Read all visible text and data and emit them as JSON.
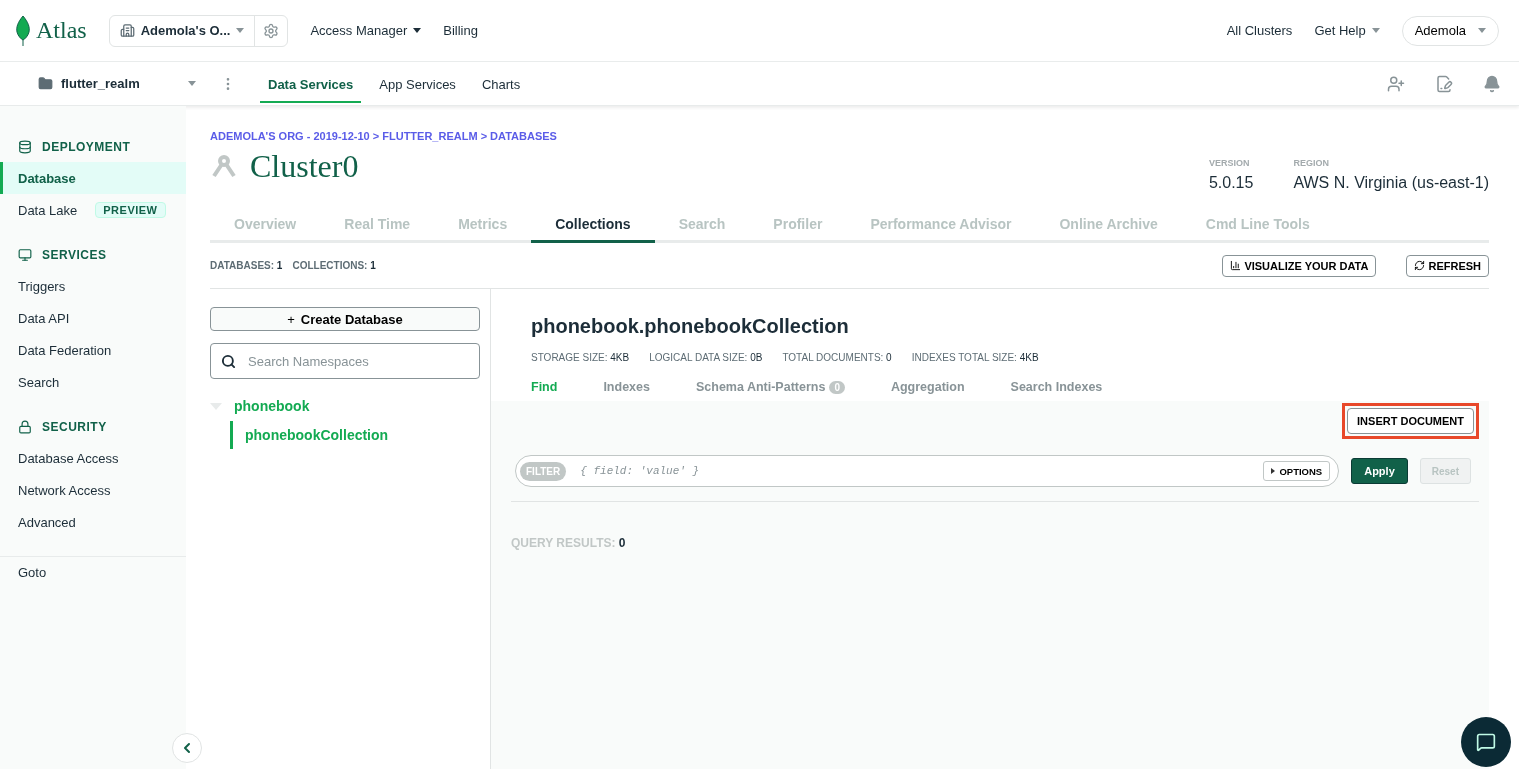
{
  "topbar": {
    "logo": "Atlas",
    "org": "Ademola's O...",
    "nav": [
      {
        "label": "Access Manager",
        "dropdown": true
      },
      {
        "label": "Billing",
        "dropdown": false
      }
    ],
    "right": [
      {
        "label": "All Clusters",
        "dropdown": false
      },
      {
        "label": "Get Help",
        "dropdown": true
      }
    ],
    "user": "Ademola"
  },
  "projectbar": {
    "project": "flutter_realm",
    "tabs": [
      {
        "label": "Data Services",
        "selected": true
      },
      {
        "label": "App Services",
        "selected": false
      },
      {
        "label": "Charts",
        "selected": false
      }
    ]
  },
  "sidebar": {
    "sections": [
      {
        "title": "DEPLOYMENT",
        "items": [
          {
            "label": "Database",
            "selected": true
          },
          {
            "label": "Data Lake",
            "selected": false,
            "badge": "PREVIEW"
          }
        ]
      },
      {
        "title": "SERVICES",
        "items": [
          {
            "label": "Triggers",
            "selected": false
          },
          {
            "label": "Data API",
            "selected": false
          },
          {
            "label": "Data Federation",
            "selected": false
          },
          {
            "label": "Search",
            "selected": false
          }
        ]
      },
      {
        "title": "SECURITY",
        "items": [
          {
            "label": "Database Access",
            "selected": false
          },
          {
            "label": "Network Access",
            "selected": false
          },
          {
            "label": "Advanced",
            "selected": false
          }
        ]
      }
    ],
    "footer": "Goto"
  },
  "breadcrumb": "ADEMOLA'S ORG - 2019-12-10 > FLUTTER_REALM > DATABASES",
  "cluster": {
    "name": "Cluster0",
    "meta": [
      {
        "label": "VERSION",
        "value": "5.0.15"
      },
      {
        "label": "REGION",
        "value": "AWS N. Virginia (us-east-1)"
      }
    ]
  },
  "tabs": [
    {
      "label": "Overview",
      "selected": false
    },
    {
      "label": "Real Time",
      "selected": false
    },
    {
      "label": "Metrics",
      "selected": false
    },
    {
      "label": "Collections",
      "selected": true
    },
    {
      "label": "Search",
      "selected": false
    },
    {
      "label": "Profiler",
      "selected": false
    },
    {
      "label": "Performance Advisor",
      "selected": false
    },
    {
      "label": "Online Archive",
      "selected": false
    },
    {
      "label": "Cmd Line Tools",
      "selected": false
    }
  ],
  "counts": [
    {
      "label": "DATABASES:",
      "value": "1"
    },
    {
      "label": "COLLECTIONS:",
      "value": "1"
    }
  ],
  "actions": [
    {
      "label": "VISUALIZE YOUR DATA"
    },
    {
      "label": "REFRESH"
    }
  ],
  "left_panel": {
    "create_prefix": "+",
    "create": "Create Database",
    "search_placeholder": "Search Namespaces",
    "tree": [
      {
        "label": "phonebook",
        "expanded": true,
        "children": [
          {
            "label": "phonebookCollection",
            "selected": true
          }
        ]
      }
    ]
  },
  "collection": {
    "title": "phonebook.phonebookCollection",
    "stats": [
      {
        "label": "STORAGE SIZE:",
        "value": "4KB"
      },
      {
        "label": "LOGICAL DATA SIZE:",
        "value": "0B"
      },
      {
        "label": "TOTAL DOCUMENTS:",
        "value": "0"
      },
      {
        "label": "INDEXES TOTAL SIZE:",
        "value": "4KB"
      }
    ],
    "tabs": [
      {
        "label": "Find",
        "selected": true
      },
      {
        "label": "Indexes",
        "selected": false
      },
      {
        "label": "Schema Anti-Patterns",
        "selected": false,
        "badge": "0"
      },
      {
        "label": "Aggregation",
        "selected": false
      },
      {
        "label": "Search Indexes",
        "selected": false
      }
    ],
    "insert": {
      "label": "INSERT DOCUMENT",
      "highlighted": true
    },
    "filter": {
      "tag": "FILTER",
      "placeholder": "{ field: 'value' }",
      "options": "OPTIONS"
    },
    "apply": "Apply",
    "reset": "Reset",
    "results_label": "QUERY RESULTS:",
    "results_value": "0"
  }
}
